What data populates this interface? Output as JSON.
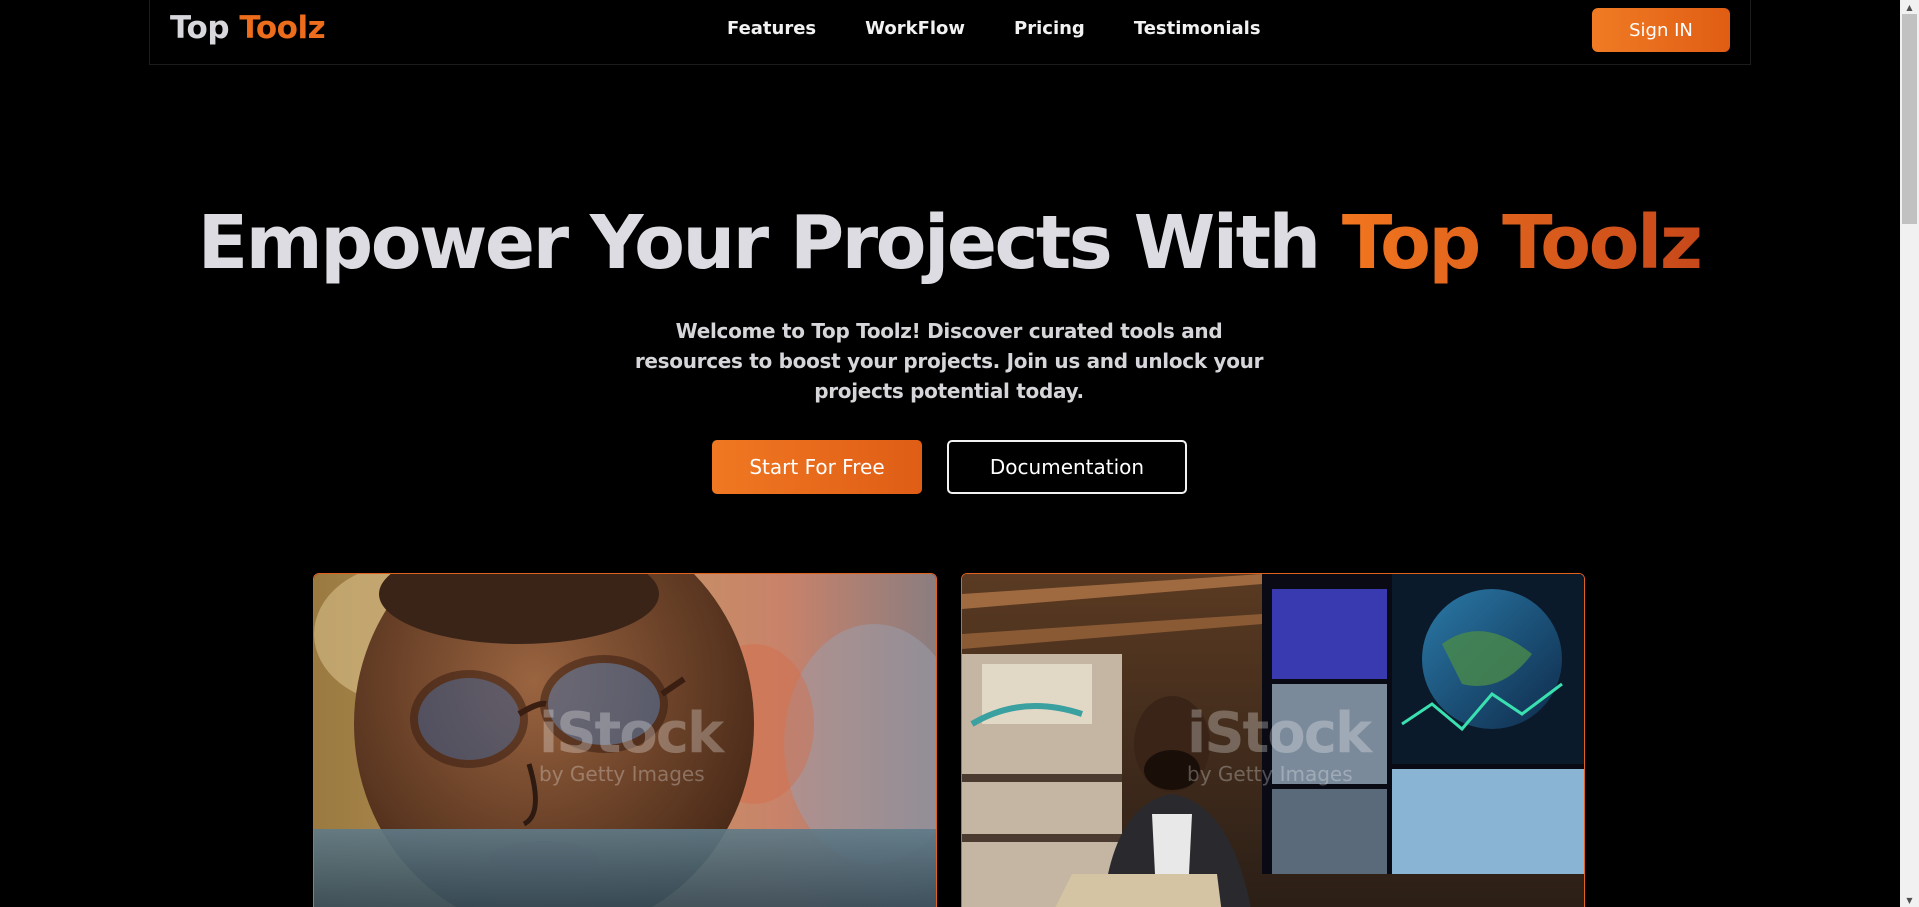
{
  "nav": {
    "logo_part1": "Top",
    "logo_part2": "Toolz",
    "links": [
      "Features",
      "WorkFlow",
      "Pricing",
      "Testimonials"
    ],
    "signin_label": "Sign IN"
  },
  "hero": {
    "title_part1": "Empower Your Projects With",
    "title_accent": "Top Toolz",
    "subtitle": "Welcome to Top Toolz! Discover curated tools and resources to boost your projects. Join us and unlock your projects potential today.",
    "primary_cta": "Start For Free",
    "secondary_cta": "Documentation"
  },
  "cards": [
    {
      "watermark_main": "iStock",
      "watermark_sub": "by Getty Images"
    },
    {
      "watermark_main": "iStock",
      "watermark_sub": "by Getty Images"
    }
  ],
  "colors": {
    "accent": "#ee6d1c",
    "background": "#000000",
    "text": "#dcdce2"
  },
  "icons": {
    "scroll_up": "triangle-up-icon",
    "scroll_down": "triangle-down-icon"
  }
}
